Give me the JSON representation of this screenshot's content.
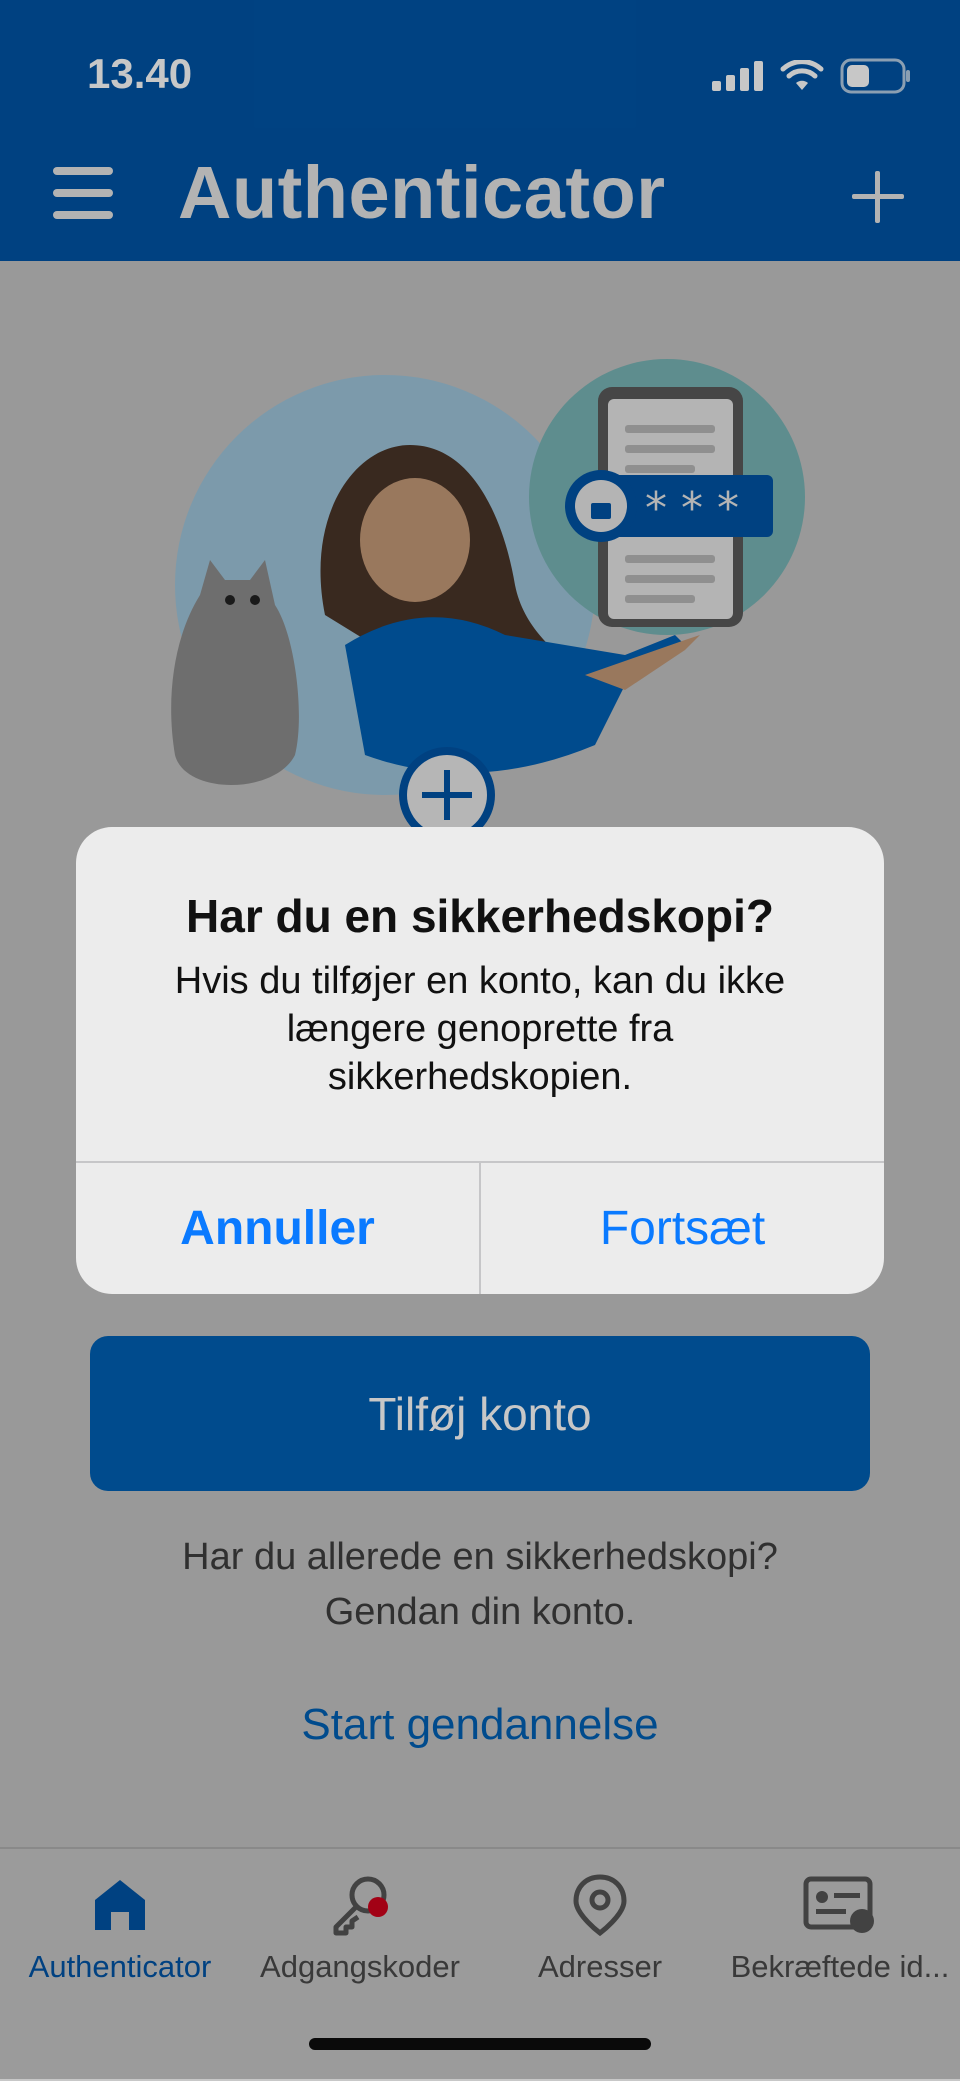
{
  "status_bar": {
    "time": "13.40"
  },
  "app_bar": {
    "title": "Authenticator"
  },
  "main": {
    "add_account_label": "Tilføj konto",
    "restore_line1": "Har du allerede en sikkerhedskopi?",
    "restore_line2": "Gendan din konto.",
    "restore_link": "Start gendannelse"
  },
  "dialog": {
    "title": "Har du en sikkerhedskopi?",
    "message": "Hvis du tilføjer en konto, kan du ikke længere genoprette fra sikkerhedskopien.",
    "cancel_label": "Annuller",
    "continue_label": "Fortsæt"
  },
  "tabbar": {
    "items": [
      {
        "label": "Authenticator",
        "icon": "home-icon",
        "active": true
      },
      {
        "label": "Adgangskoder",
        "icon": "key-icon",
        "badge": true
      },
      {
        "label": "Adresser",
        "icon": "location-pin-icon"
      },
      {
        "label": "Bekræftede id...",
        "icon": "verified-id-icon"
      }
    ]
  },
  "colors": {
    "brand_blue": "#0054a6",
    "button_blue": "#0061b5",
    "ios_blue": "#0a7aff",
    "badge_red": "#d0021b"
  }
}
